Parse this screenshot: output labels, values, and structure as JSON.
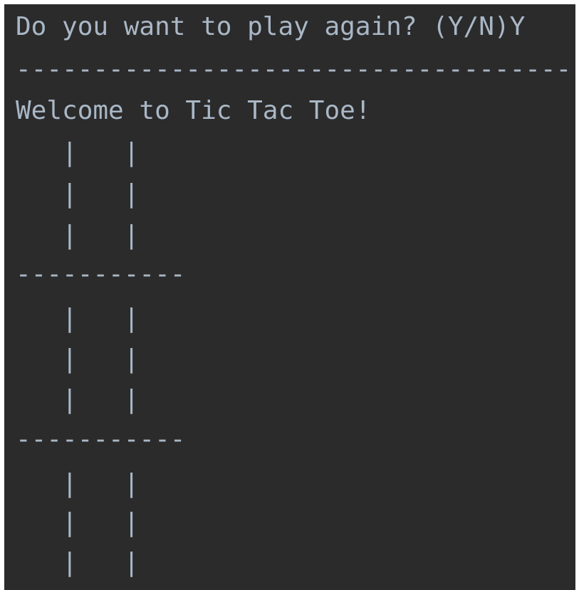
{
  "console": {
    "prompt": "Do you want to play again? (Y/N)",
    "user_input": "Y",
    "separator": "------------------------------------",
    "welcome": "Welcome to Tic Tac Toe!",
    "board": {
      "rows": [
        {
          "cells": "   |   |   "
        },
        {
          "cells": "   |   |   "
        },
        {
          "cells": "   |   |   "
        },
        {
          "cells": "   |   |   "
        },
        {
          "cells": "   |   |   "
        },
        {
          "cells": "   |   |   "
        },
        {
          "cells": "   |   |   "
        },
        {
          "cells": "   |   |   "
        },
        {
          "cells": "   |   |   "
        }
      ],
      "separators": [
        "-----------",
        "-----------"
      ]
    },
    "colors": {
      "background": "#2b2b2b",
      "text": "#a9b7c6"
    }
  }
}
